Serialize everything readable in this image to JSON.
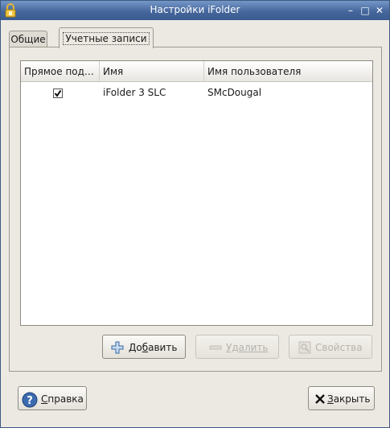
{
  "window": {
    "title": "Настройки iFolder",
    "controls": {
      "minimize": "–",
      "maximize": "□",
      "close": "✕"
    },
    "app_icon": "ifolder-lock-icon",
    "accent_color": "#4a6ea3"
  },
  "tabs": [
    {
      "label": "Общие",
      "active": false
    },
    {
      "label": "Учетные записи",
      "active": true
    }
  ],
  "accounts_table": {
    "columns": [
      "Прямое под…",
      "Имя",
      "Имя пользователя"
    ],
    "rows": [
      {
        "direct_connect": true,
        "name": "iFolder 3 SLC",
        "user": "SMcDougal"
      }
    ]
  },
  "actions": {
    "add_prefix": "До",
    "add_mnemonic": "б",
    "add_suffix": "авить",
    "remove": "Удалить",
    "properties": "Свойства"
  },
  "footer": {
    "help_mnemonic": "С",
    "help_rest": "правка",
    "close_mnemonic": "З",
    "close_rest": "акрыть"
  }
}
